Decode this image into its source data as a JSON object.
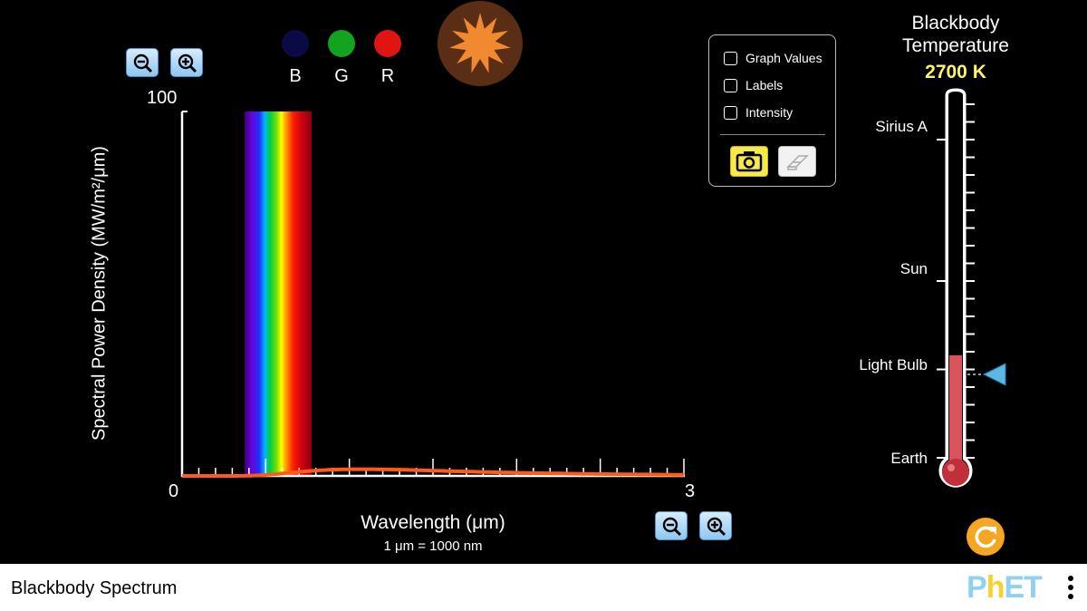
{
  "graph": {
    "y_max_label": "100",
    "x_min_label": "0",
    "x_max_label": "3",
    "y_axis_title": "Spectral Power Density (MW/m²/μm)",
    "x_axis_title": "Wavelength (μm)",
    "unit_note": "1 μm  =  1000 nm"
  },
  "rgb": {
    "b_label": "B",
    "g_label": "G",
    "r_label": "R",
    "b_color": "#0a0a45",
    "g_color": "#13a31f",
    "r_color": "#e11414"
  },
  "controls": {
    "graph_values": "Graph Values",
    "labels": "Labels",
    "intensity": "Intensity",
    "camera_icon": "camera-icon",
    "eraser_icon": "eraser-icon"
  },
  "thermometer": {
    "title_line1": "Blackbody",
    "title_line2": "Temperature",
    "temperature": "2700 K",
    "labels": {
      "sirius": "Sirius A",
      "sun": "Sun",
      "light_bulb": "Light Bulb",
      "earth": "Earth"
    },
    "fill_fraction": 0.29
  },
  "footer": {
    "title": "Blackbody Spectrum",
    "brand": "PhET"
  },
  "colors": {
    "accent_yellow": "#fff36b",
    "curve": "#ff5a1a",
    "star": "#f0892f",
    "star_bg": "#5a2e14",
    "reset": "#f5a623"
  }
}
